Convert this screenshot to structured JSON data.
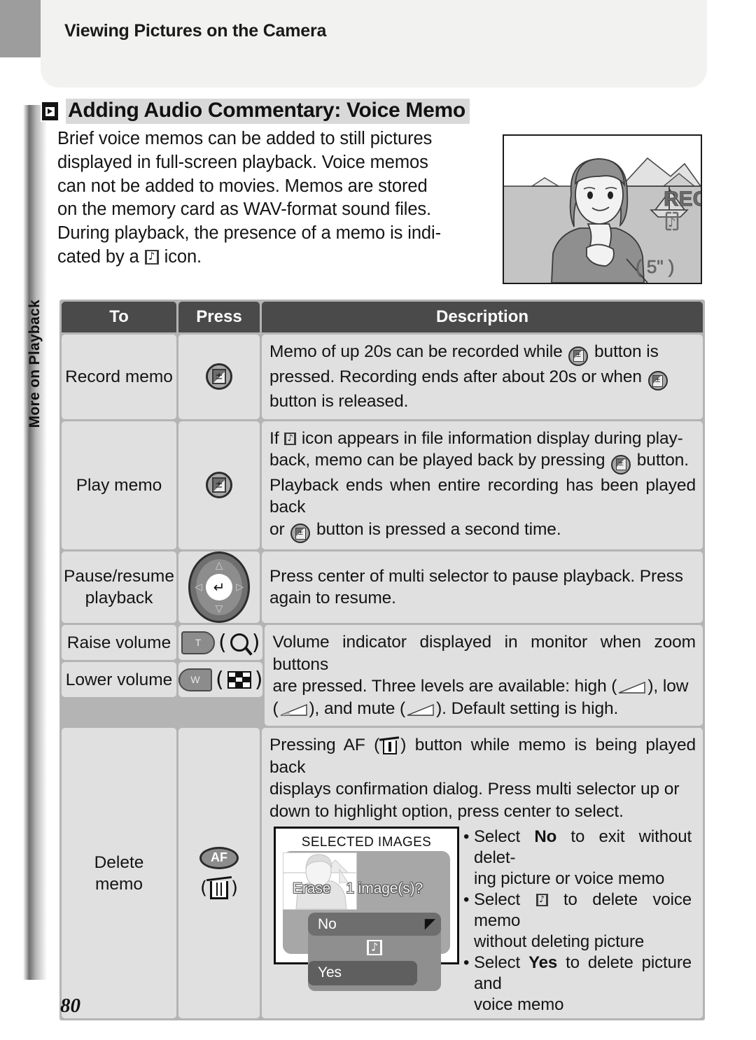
{
  "header": {
    "running_title": "Viewing Pictures on the Camera"
  },
  "section": {
    "icon": "playback-icon",
    "title": "Adding Audio Commentary: Voice Memo"
  },
  "side_tab": {
    "label": "More on Playback"
  },
  "intro": {
    "line1": "Brief voice memos can be added to still pictures",
    "line2": "displayed in full-screen playback.  Voice memos",
    "line3": "can not be added to movies.  Memos are stored",
    "line4": "on the memory card as WAV-format sound files.",
    "line5": "During playback, the presence of a memo is indi-",
    "line6_pre": "cated by a ",
    "line6_post": " icon."
  },
  "illustration": {
    "name": "camera-monitor-voice-memo-recording",
    "rec_label": "REC",
    "time_label": "( 5\" )",
    "memo_icon": "sound-memo-icon"
  },
  "table": {
    "headers": {
      "to": "To",
      "press": "Press",
      "description": "Description"
    },
    "rows": [
      {
        "to": "Record memo",
        "press_icon": "exposure-compensation-button",
        "desc_l1_a": "Memo of up 20",
        "desc_l1_b": "s can be recorded while ",
        "desc_l1_c": " button is",
        "desc_l2_a": "pressed.  Recording ends after about 20",
        "desc_l2_b": "s or when ",
        "desc_l3": "button is released."
      },
      {
        "to": "Play memo",
        "press_icon": "exposure-compensation-button",
        "desc_l1_a": "If ",
        "desc_l1_b": " icon appears in file information display during play-",
        "desc_l2_a": "back, memo can be played back by pressing ",
        "desc_l2_b": " button.",
        "desc_l3": "Playback ends when entire recording has been played back",
        "desc_l4_a": "or ",
        "desc_l4_b": " button is pressed a second time."
      },
      {
        "to_line1": "Pause/resume",
        "to_line2": "playback",
        "press_icon": "multi-selector",
        "desc_l1": "Press center of multi selector to pause playback.  Press",
        "desc_l2": "again to resume."
      },
      {
        "to_raise": "Raise volume",
        "to_lower": "Lower volume",
        "press_icon_raise": "zoom-tele-button",
        "press_icon_lower": "zoom-wide-button",
        "desc_l1": "Volume indicator displayed in monitor when zoom buttons",
        "desc_l2_a": "are pressed.  Three levels are available: high (",
        "desc_l2_b": "), low",
        "desc_l3_a": "(",
        "desc_l3_b": "), and mute (",
        "desc_l3_c": ").  Default setting is high."
      },
      {
        "to_line1": "Delete",
        "to_line2": "memo",
        "press_icon_af": "af-button",
        "press_icon_trash": "trash-icon",
        "desc_l1_a": "Pressing AF (",
        "desc_l1_b": ") button while memo is being played back",
        "desc_l2": "displays confirmation dialog.  Press multi selector up or",
        "desc_l3": "down to highlight option, press center to select.",
        "lcd": {
          "title": "SELECTED IMAGES",
          "erase_label": "Erase",
          "erase_count": "1 image(s)?",
          "option_no": "No",
          "option_memo_icon": "sound-memo-icon",
          "option_yes": "Yes",
          "enter_icon": "enter-icon"
        },
        "bullets": [
          {
            "pre": "Select ",
            "bold": "No",
            "post": " to exit without delet-",
            "cont": "ing picture or voice memo"
          },
          {
            "pre": "Select ",
            "icon": "sound-memo-icon",
            "post": " to delete voice memo",
            "cont": "without deleting picture"
          },
          {
            "pre": "Select ",
            "bold": "Yes",
            "post": " to delete picture and",
            "cont": "voice memo"
          }
        ]
      }
    ]
  },
  "footer": {
    "page_number": "80"
  },
  "colors": {
    "table_header_bg": "#4a4a4a",
    "table_cell_bg": "#e0e0e0",
    "table_grid": "#b4b4b4",
    "heading_highlight": "#d9d9d9",
    "panel_bg": "#f2f2f0",
    "tab_gray": "#9d9d9d"
  }
}
